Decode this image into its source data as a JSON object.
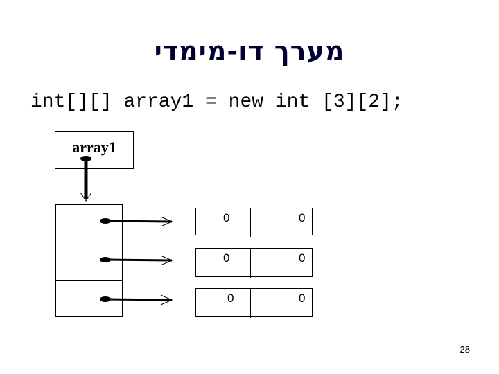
{
  "slide": {
    "title": "מערך דו-מימדי",
    "code": "int[][] array1 = new int [3][2];",
    "variable_label": "array1",
    "outer_array_cells": 3,
    "inner_arrays": [
      {
        "values": [
          "0",
          "0"
        ]
      },
      {
        "values": [
          "0",
          "0"
        ]
      },
      {
        "values": [
          "0",
          "0"
        ]
      }
    ],
    "page_number": "28"
  }
}
